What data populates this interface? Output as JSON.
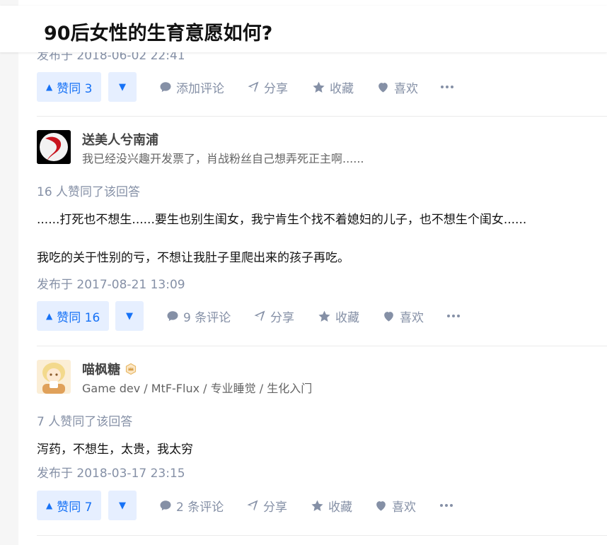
{
  "question": {
    "title": "90后女性的生育意愿如何?"
  },
  "prev_answer": {
    "date": "发布于 2018-06-02 22:41",
    "actions": {
      "upvote": "赞同 3",
      "comment": "添加评论",
      "share": "分享",
      "favorite": "收藏",
      "like": "喜欢"
    }
  },
  "answers": [
    {
      "author": {
        "name": "送美人兮南浦",
        "headline": "我已经没兴趣开发票了，肖战粉丝自己想弄死正主啊......"
      },
      "vote_text": "16 人赞同了该回答",
      "content": [
        "......打死也不想生......要生也别生闺女，我宁肯生个找不着媳妇的儿子，也不想生个闺女......",
        "我吃的关于性别的亏，不想让我肚子里爬出来的孩子再吃。"
      ],
      "date": "发布于 2017-08-21 13:09",
      "actions": {
        "upvote": "赞同 16",
        "comment": "9 条评论",
        "share": "分享",
        "favorite": "收藏",
        "like": "喜欢"
      }
    },
    {
      "author": {
        "name": "喵枫糖",
        "headline": "Game dev / MtF-Flux / 专业睡觉 / 生化入门"
      },
      "vote_text": "7 人赞同了该回答",
      "content": [
        "泻药，不想生，太贵，我太穷"
      ],
      "date": "发布于 2018-03-17 23:15",
      "actions": {
        "upvote": "赞同 7",
        "comment": "2 条评论",
        "share": "分享",
        "favorite": "收藏",
        "like": "喜欢"
      }
    }
  ],
  "icons": {
    "upvote": "triangle-up-icon",
    "downvote": "triangle-down-icon",
    "comment": "comment-bubble-icon",
    "share": "paper-plane-icon",
    "favorite": "star-icon",
    "like": "heart-icon",
    "more": "ellipsis-icon",
    "badge": "crown-badge-icon"
  },
  "colors": {
    "accent": "#1772f6",
    "accent_bg": "#e6efff",
    "muted": "#8590a6",
    "text": "#121212"
  }
}
